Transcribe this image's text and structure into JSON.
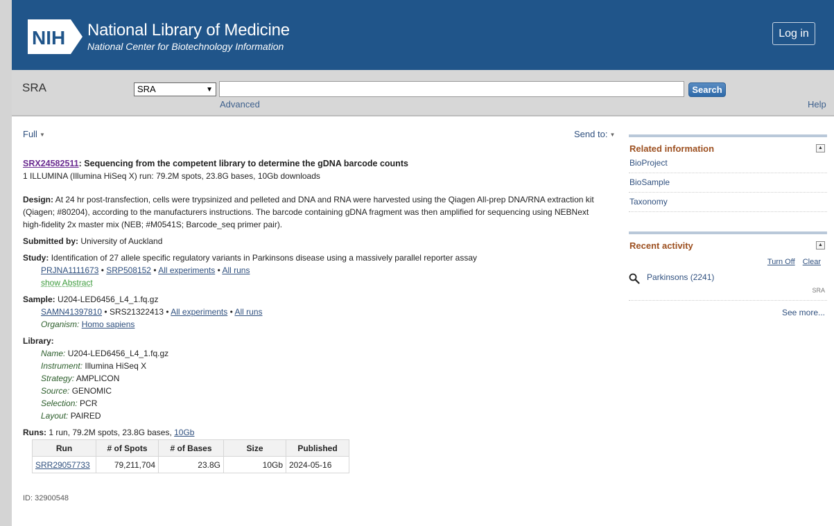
{
  "header": {
    "logo_text": "NIH",
    "title": "National Library of Medicine",
    "subtitle": "National Center for Biotechnology Information",
    "login_label": "Log in"
  },
  "search": {
    "db_name": "SRA",
    "db_selected": "SRA",
    "query": "",
    "button_label": "Search",
    "advanced_label": "Advanced",
    "help_label": "Help"
  },
  "controls": {
    "format_label": "Full",
    "sendto_label": "Send to:"
  },
  "record": {
    "accession": "SRX24582511",
    "title": ": Sequencing from the competent library to determine the gDNA barcode counts",
    "summary": "1 ILLUMINA (Illumina HiSeq X) run: 79.2M spots, 23.8G bases, 10Gb downloads",
    "design_label": "Design:",
    "design_text": "At 24 hr post-transfection, cells were trypsinized and pelleted and DNA and RNA were harvested using the Qiagen All-prep DNA/RNA extraction kit (Qiagen; #80204), according to the manufacturers instructions. The barcode containing gDNA fragment was then amplified for sequencing using NEBNext high-fidelity 2x master mix (NEB; #M0541S; Barcode_seq primer pair).",
    "submitted_label": "Submitted by:",
    "submitted_by": "University of Auckland",
    "study_label": "Study:",
    "study_title": "Identification of 27 allele specific regulatory variants in Parkinsons disease using a massively parallel reporter assay",
    "study_links": [
      "PRJNA1111673",
      "SRP508152",
      "All experiments",
      "All runs"
    ],
    "show_abstract": "show Abstract",
    "sample_label": "Sample:",
    "sample_name": "U204-LED6456_L4_1.fq.gz",
    "sample_biosample": "SAMN41397810",
    "sample_srs": "SRS21322413",
    "sample_links": [
      "All experiments",
      "All runs"
    ],
    "organism_label": "Organism:",
    "organism": "Homo sapiens",
    "library_label": "Library:",
    "library": [
      {
        "k": "Name:",
        "v": "U204-LED6456_L4_1.fq.gz"
      },
      {
        "k": "Instrument:",
        "v": "Illumina HiSeq X"
      },
      {
        "k": "Strategy:",
        "v": "AMPLICON"
      },
      {
        "k": "Source:",
        "v": "GENOMIC"
      },
      {
        "k": "Selection:",
        "v": "PCR"
      },
      {
        "k": "Layout:",
        "v": "PAIRED"
      }
    ],
    "runs_label": "Runs:",
    "runs_text": "1 run, 79.2M spots, 23.8G bases,",
    "runs_size_link": "10Gb",
    "runs_table": {
      "headers": [
        "Run",
        "# of Spots",
        "# of Bases",
        "Size",
        "Published"
      ],
      "rows": [
        [
          "SRR29057733",
          "79,211,704",
          "23.8G",
          "10Gb",
          "2024-05-16"
        ]
      ]
    },
    "id_line": "ID: 32900548"
  },
  "sidebar": {
    "related_title": "Related information",
    "related_links": [
      "BioProject",
      "BioSample",
      "Taxonomy"
    ],
    "recent_title": "Recent activity",
    "turn_off": "Turn Off",
    "clear": "Clear",
    "recent_item": "Parkinsons (2241)",
    "recent_item_db": "SRA",
    "see_more": "See more..."
  },
  "colors": {
    "header_bg": "#20558a",
    "accent_link": "#2e4f7e",
    "sidebar_title": "#9c4f1f"
  }
}
